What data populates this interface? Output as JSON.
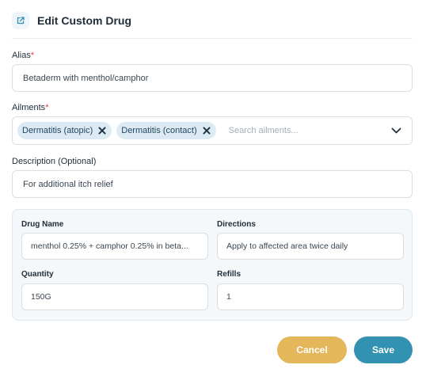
{
  "header": {
    "title": "Edit Custom Drug",
    "icon": "external-link-icon"
  },
  "alias": {
    "label": "Alias",
    "required_mark": "*",
    "value": "Betaderm with menthol/camphor"
  },
  "ailments": {
    "label": "Ailments",
    "required_mark": "*",
    "chips": [
      "Dermatitis (atopic)",
      "Dermatitis (contact)"
    ],
    "placeholder": "Search ailments..."
  },
  "description": {
    "label": "Description (Optional)",
    "value": "For additional itch relief"
  },
  "drug": {
    "name_label": "Drug Name",
    "name_value": "menthol 0.25% + camphor 0.25% in beta...",
    "directions_label": "Directions",
    "directions_value": "Apply to affected area twice daily",
    "quantity_label": "Quantity",
    "quantity_value": "150G",
    "refills_label": "Refills",
    "refills_value": "1"
  },
  "actions": {
    "cancel_label": "Cancel",
    "save_label": "Save"
  },
  "colors": {
    "accent": "#3391b1",
    "cancel": "#e3b75a",
    "chip_bg": "#dcebf3",
    "required": "#e53935"
  }
}
